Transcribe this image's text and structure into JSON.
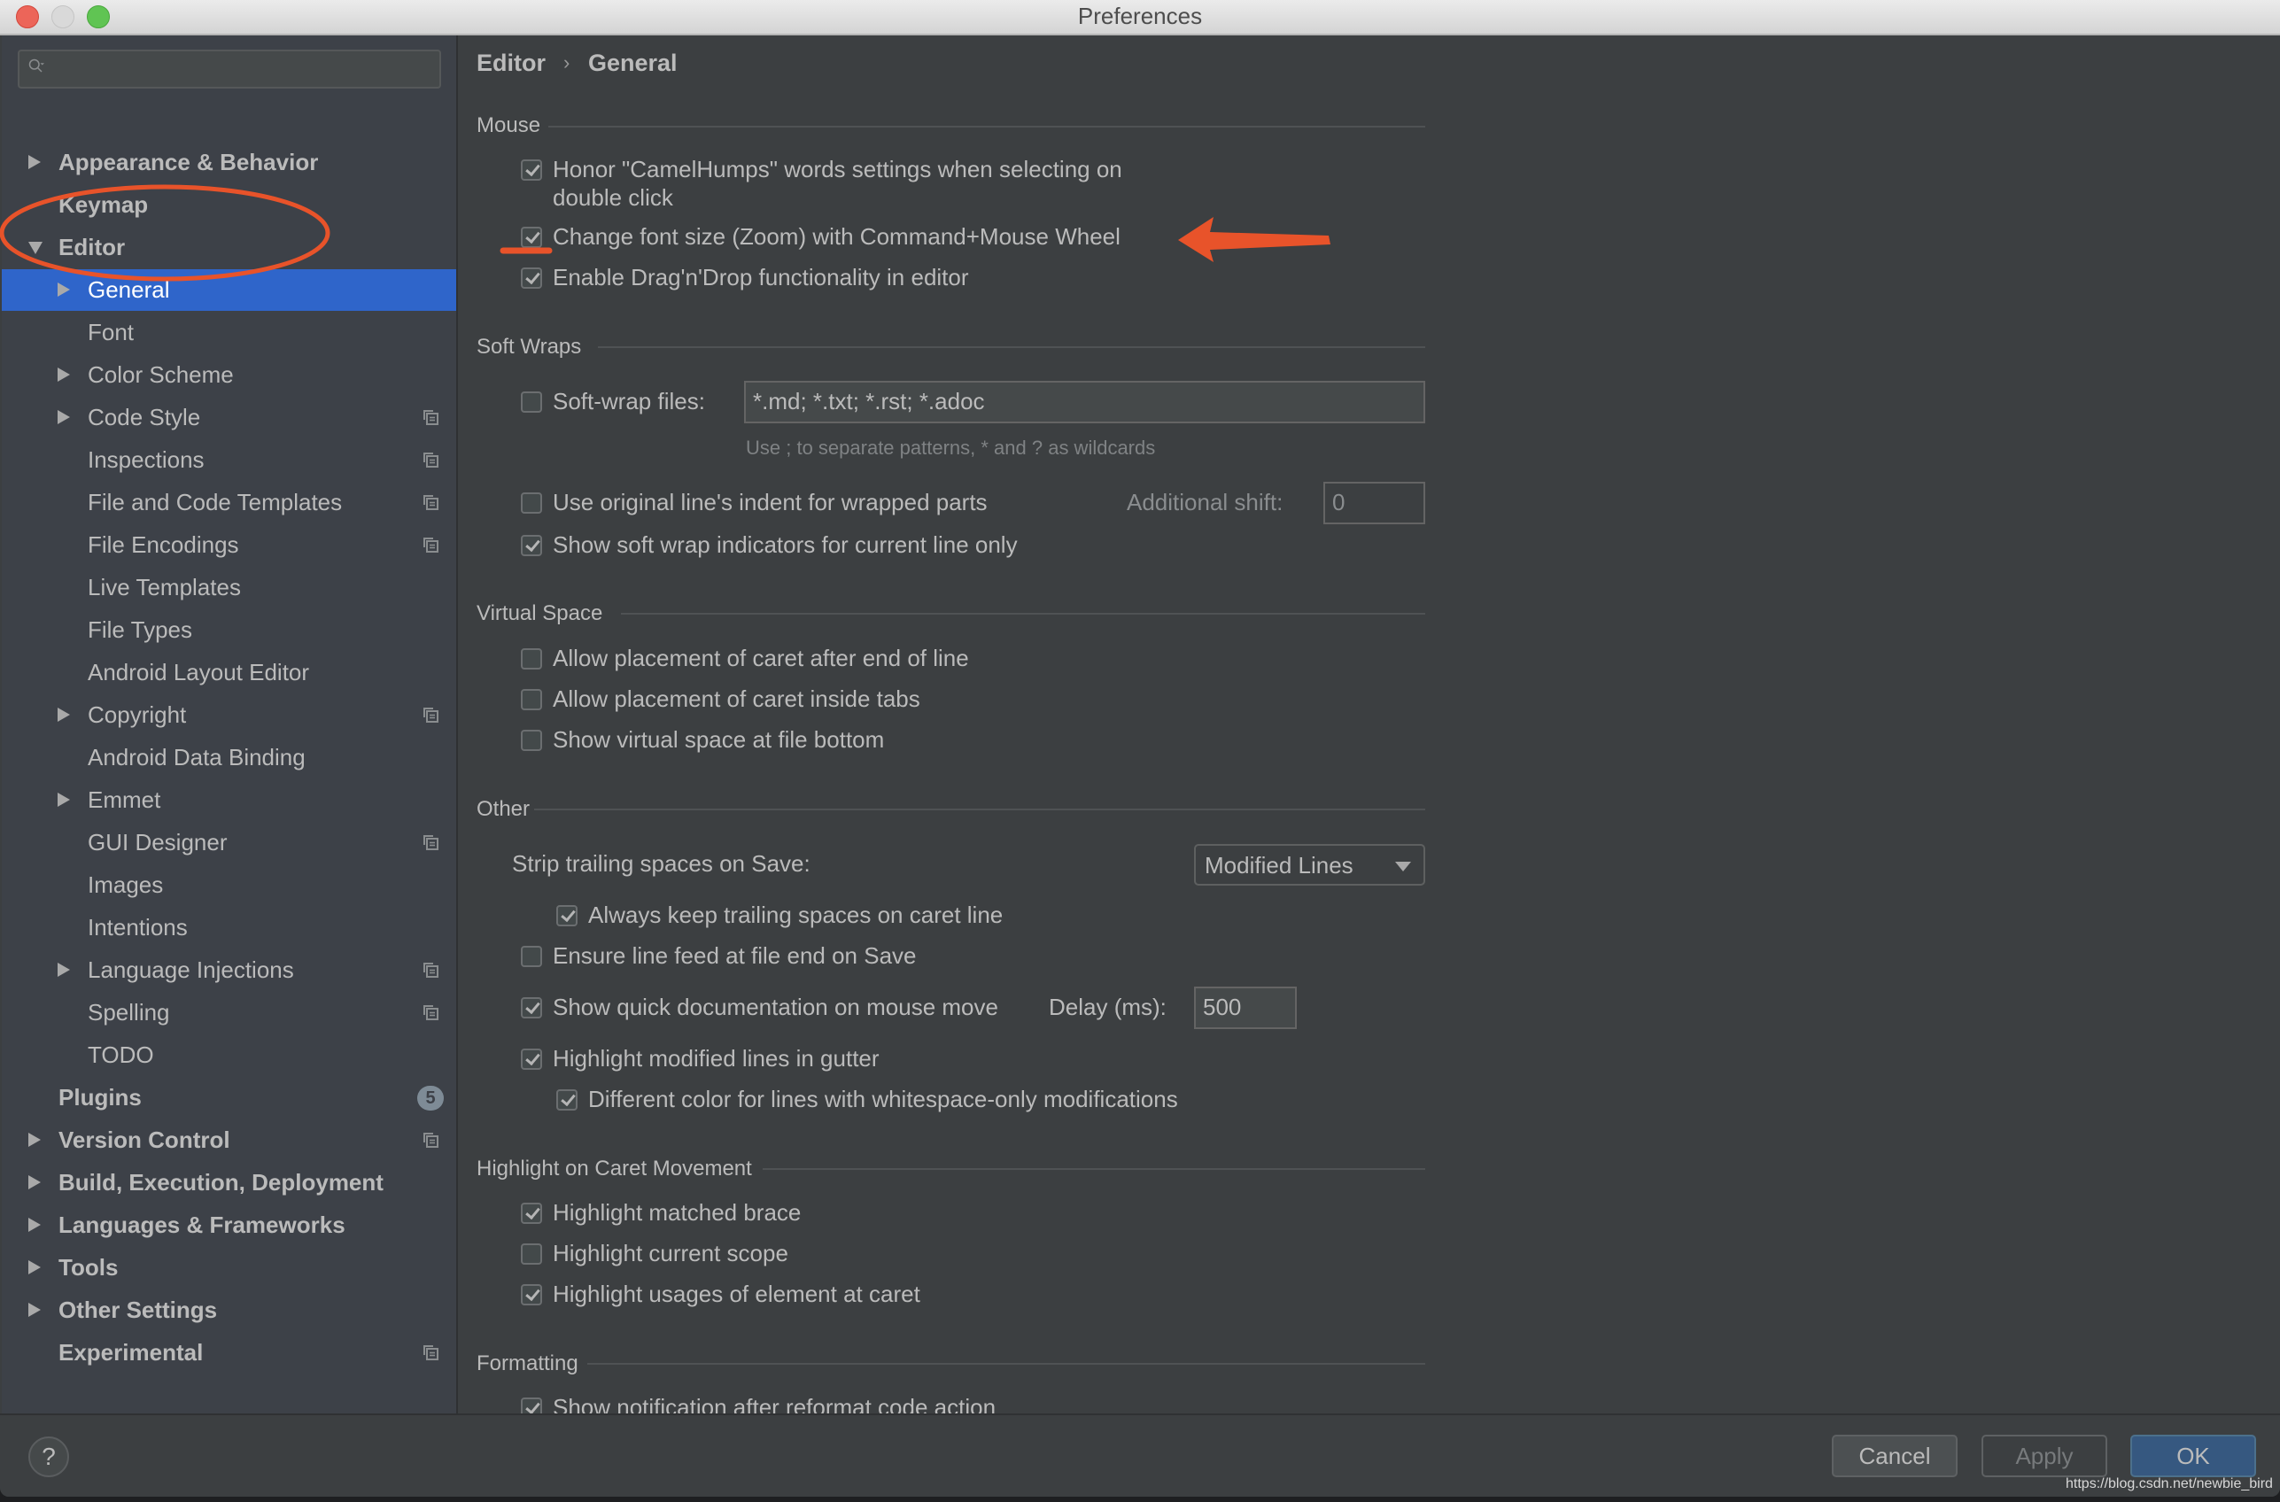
{
  "window": {
    "title": "Preferences"
  },
  "search": {
    "placeholder": "",
    "value": ""
  },
  "sidebar": {
    "items": [
      {
        "label": "Appearance & Behavior",
        "level": 0,
        "expandable": true,
        "expanded": false,
        "bold": true,
        "project_icon": false
      },
      {
        "label": "Keymap",
        "level": 0,
        "expandable": false,
        "bold": true,
        "project_icon": false
      },
      {
        "label": "Editor",
        "level": 0,
        "expandable": true,
        "expanded": true,
        "bold": true,
        "project_icon": false
      },
      {
        "label": "General",
        "level": 1,
        "expandable": true,
        "expanded": false,
        "selected": true,
        "project_icon": false
      },
      {
        "label": "Font",
        "level": 1,
        "expandable": false,
        "project_icon": false
      },
      {
        "label": "Color Scheme",
        "level": 1,
        "expandable": true,
        "project_icon": false
      },
      {
        "label": "Code Style",
        "level": 1,
        "expandable": true,
        "project_icon": true
      },
      {
        "label": "Inspections",
        "level": 1,
        "expandable": false,
        "project_icon": true
      },
      {
        "label": "File and Code Templates",
        "level": 1,
        "expandable": false,
        "project_icon": true
      },
      {
        "label": "File Encodings",
        "level": 1,
        "expandable": false,
        "project_icon": true
      },
      {
        "label": "Live Templates",
        "level": 1,
        "expandable": false,
        "project_icon": false
      },
      {
        "label": "File Types",
        "level": 1,
        "expandable": false,
        "project_icon": false
      },
      {
        "label": "Android Layout Editor",
        "level": 1,
        "expandable": false,
        "project_icon": false
      },
      {
        "label": "Copyright",
        "level": 1,
        "expandable": true,
        "project_icon": true
      },
      {
        "label": "Android Data Binding",
        "level": 1,
        "expandable": false,
        "project_icon": false
      },
      {
        "label": "Emmet",
        "level": 1,
        "expandable": true,
        "project_icon": false
      },
      {
        "label": "GUI Designer",
        "level": 1,
        "expandable": false,
        "project_icon": true
      },
      {
        "label": "Images",
        "level": 1,
        "expandable": false,
        "project_icon": false
      },
      {
        "label": "Intentions",
        "level": 1,
        "expandable": false,
        "project_icon": false
      },
      {
        "label": "Language Injections",
        "level": 1,
        "expandable": true,
        "project_icon": true
      },
      {
        "label": "Spelling",
        "level": 1,
        "expandable": false,
        "project_icon": true
      },
      {
        "label": "TODO",
        "level": 1,
        "expandable": false,
        "project_icon": false
      },
      {
        "label": "Plugins",
        "level": 0,
        "expandable": false,
        "bold": true,
        "badge": "5"
      },
      {
        "label": "Version Control",
        "level": 0,
        "expandable": true,
        "bold": true,
        "project_icon": true
      },
      {
        "label": "Build, Execution, Deployment",
        "level": 0,
        "expandable": true,
        "bold": true,
        "project_icon": false
      },
      {
        "label": "Languages & Frameworks",
        "level": 0,
        "expandable": true,
        "bold": true,
        "project_icon": false
      },
      {
        "label": "Tools",
        "level": 0,
        "expandable": true,
        "bold": true,
        "project_icon": false
      },
      {
        "label": "Other Settings",
        "level": 0,
        "expandable": true,
        "bold": true,
        "project_icon": false
      },
      {
        "label": "Experimental",
        "level": 0,
        "expandable": false,
        "bold": true,
        "project_icon": true
      }
    ]
  },
  "breadcrumb": {
    "parent": "Editor",
    "separator": "›",
    "current": "General"
  },
  "sections": {
    "mouse": {
      "title": "Mouse",
      "honor_camelhumps": {
        "label_line1": "Honor \"CamelHumps\" words settings when selecting on",
        "label_line2": "double click",
        "checked": true
      },
      "zoom_font": {
        "label": "Change font size (Zoom) with Command+Mouse Wheel",
        "checked": true
      },
      "drag_drop": {
        "label": "Enable Drag'n'Drop functionality in editor",
        "checked": true
      }
    },
    "soft_wraps": {
      "title": "Soft Wraps",
      "soft_wrap_files": {
        "label": "Soft-wrap files:",
        "checked": false,
        "value": "*.md; *.txt; *.rst; *.adoc"
      },
      "hint": "Use ; to separate patterns, * and ? as wildcards",
      "original_indent": {
        "label": "Use original line's indent for wrapped parts",
        "checked": false
      },
      "additional_shift": {
        "label": "Additional shift:",
        "value": "0"
      },
      "show_indicators": {
        "label": "Show soft wrap indicators for current line only",
        "checked": true
      }
    },
    "virtual_space": {
      "title": "Virtual Space",
      "after_eol": {
        "label": "Allow placement of caret after end of line",
        "checked": false
      },
      "inside_tabs": {
        "label": "Allow placement of caret inside tabs",
        "checked": false
      },
      "file_bottom": {
        "label": "Show virtual space at file bottom",
        "checked": false
      }
    },
    "other": {
      "title": "Other",
      "strip_trailing": {
        "label": "Strip trailing spaces on Save:",
        "selected": "Modified Lines"
      },
      "keep_trailing": {
        "label": "Always keep trailing spaces on caret line",
        "checked": true
      },
      "line_feed": {
        "label": "Ensure line feed at file end on Save",
        "checked": false
      },
      "quick_doc": {
        "label": "Show quick documentation on mouse move",
        "checked": true,
        "delay_label": "Delay (ms):",
        "delay_value": "500"
      },
      "highlight_modified": {
        "label": "Highlight modified lines in gutter",
        "checked": true
      },
      "whitespace_color": {
        "label": "Different color for lines with whitespace-only modifications",
        "checked": true
      }
    },
    "caret_highlight": {
      "title": "Highlight on Caret Movement",
      "matched_brace": {
        "label": "Highlight matched brace",
        "checked": true
      },
      "current_scope": {
        "label": "Highlight current scope",
        "checked": false
      },
      "usages": {
        "label": "Highlight usages of element at caret",
        "checked": true
      }
    },
    "formatting": {
      "title": "Formatting",
      "notify_reformat": {
        "label": "Show notification after reformat code action",
        "checked": true
      }
    }
  },
  "footer": {
    "help_label": "?",
    "cancel_label": "Cancel",
    "apply_label": "Apply",
    "ok_label": "OK"
  },
  "watermark": "https://blog.csdn.net/newbie_bird",
  "colors": {
    "selection": "#2f65ca",
    "annotation": "#e8532a",
    "ok_button": "#365880"
  }
}
